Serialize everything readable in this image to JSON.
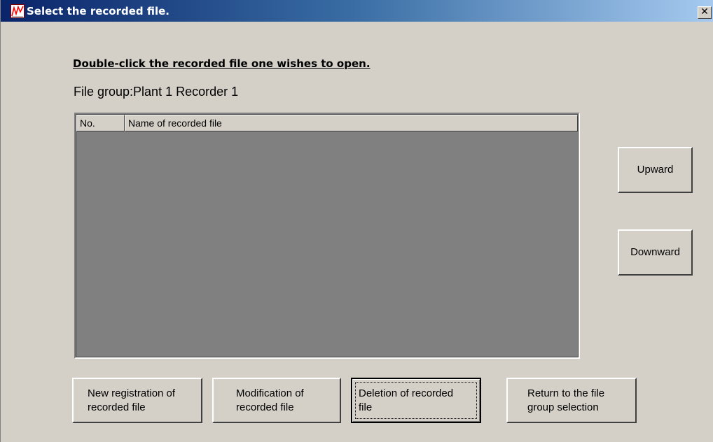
{
  "window": {
    "title": "Select the recorded file.",
    "close_glyph": "✕",
    "app_icon": "chart-line-icon"
  },
  "instruction": "Double-click the recorded file one wishes to open.",
  "file_group_label": "File group:Plant 1 Recorder 1",
  "file_list": {
    "columns": [
      "No.",
      "Name of recorded file"
    ],
    "rows": []
  },
  "side_buttons": {
    "upward": "Upward",
    "downward": "Downward"
  },
  "bottom_buttons": {
    "new_registration": "New registration of\nrecorded file",
    "modification": "Modification of\nrecorded file",
    "deletion": "Deletion of recorded\nfile",
    "return": "Return to the file\ngroup selection"
  },
  "colors": {
    "title_bar_start": "#0a246a",
    "title_bar_end": "#a6caf0",
    "dialog_bg": "#d4d0c8",
    "list_bg": "#808080"
  }
}
